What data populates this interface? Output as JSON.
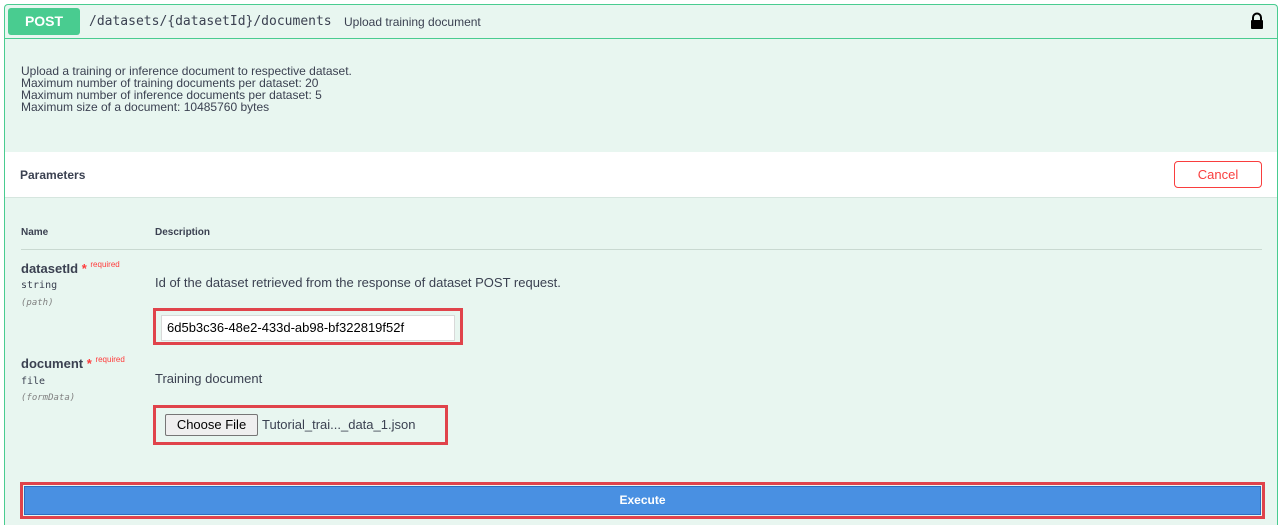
{
  "operation": {
    "method": "POST",
    "path": "/datasets/{datasetId}/documents",
    "summary": "Upload training document",
    "lock_icon": "lock-icon"
  },
  "description_lines": [
    "Upload a training or inference document to respective dataset.",
    "Maximum number of training documents per dataset: 20",
    "Maximum number of inference documents per dataset: 5",
    "Maximum size of a document: 10485760 bytes"
  ],
  "parameters": {
    "title": "Parameters",
    "cancel_label": "Cancel",
    "col_name": "Name",
    "col_description": "Description",
    "items": [
      {
        "name": "datasetId",
        "required_star": "*",
        "required_label": "required",
        "type": "string",
        "in": "(path)",
        "description": "Id of the dataset retrieved from the response of dataset POST request.",
        "value": "6d5b3c36-48e2-433d-ab98-bf322819f52f"
      },
      {
        "name": "document",
        "required_star": "*",
        "required_label": "required",
        "type": "file",
        "in": "(formData)",
        "description": "Training document",
        "choose_file_label": "Choose File",
        "file_name": "Tutorial_trai..._data_1.json"
      }
    ]
  },
  "execute_label": "Execute",
  "colors": {
    "post_green": "#49cc90",
    "background_tint": "#e8f6f0",
    "cancel_red": "#f93e3e",
    "execute_blue": "#4990e2",
    "highlight_red": "#e0434b"
  }
}
